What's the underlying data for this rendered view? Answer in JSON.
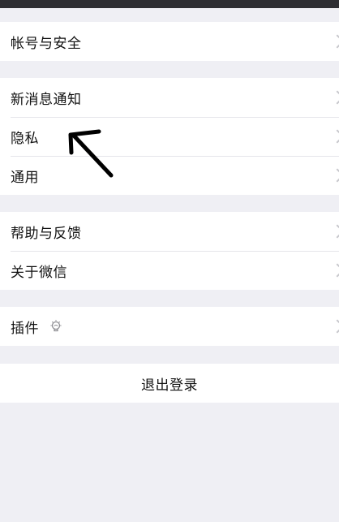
{
  "settings": {
    "account_security": "帐号与安全",
    "notifications": "新消息通知",
    "privacy": "隐私",
    "general": "通用",
    "help_feedback": "帮助与反馈",
    "about": "关于微信",
    "plugins": "插件",
    "logout": "退出登录"
  },
  "icons": {
    "chevron": "chevron-right-icon",
    "plugin": "lightbulb-icon",
    "annotation": "hand-drawn-arrow"
  },
  "colors": {
    "background": "#efeff4",
    "cell": "#ffffff",
    "chevron": "#c7c7cc",
    "topbar": "#2e2e33"
  }
}
